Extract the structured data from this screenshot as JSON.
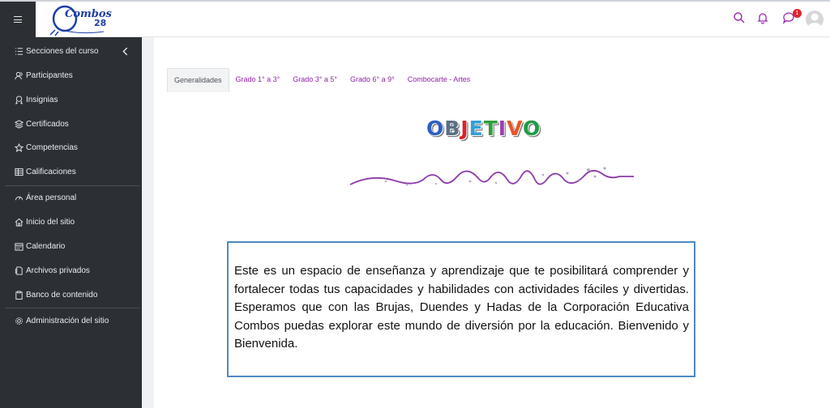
{
  "header": {
    "menu_icon": "hamburger-icon",
    "logo_text": "Combos",
    "logo_number": "28",
    "notification_badge": "1",
    "icons": [
      "search-icon",
      "bell-icon",
      "chat-icon",
      "user-avatar"
    ]
  },
  "sidebar": {
    "items": [
      {
        "label": "Secciones del curso",
        "icon": "list-icon"
      },
      {
        "label": "Participantes",
        "icon": "users-icon"
      },
      {
        "label": "Insignias",
        "icon": "badge-icon"
      },
      {
        "label": "Certificados",
        "icon": "layers-icon"
      },
      {
        "label": "Competencias",
        "icon": "star-icon"
      },
      {
        "label": "Calificaciones",
        "icon": "table-icon"
      },
      {
        "label": "Área personal",
        "icon": "dashboard-icon"
      },
      {
        "label": "Inicio del sitio",
        "icon": "home-icon"
      },
      {
        "label": "Calendario",
        "icon": "calendar-icon"
      },
      {
        "label": "Archivos privados",
        "icon": "file-icon"
      },
      {
        "label": "Banco de contenido",
        "icon": "clipboard-icon"
      },
      {
        "label": "Administración del sitio",
        "icon": "gear-icon"
      }
    ]
  },
  "tabs": [
    {
      "label": "Generalidades",
      "active": true
    },
    {
      "label": "Grado 1° a 3°",
      "active": false
    },
    {
      "label": "Grado 3° a 5°",
      "active": false
    },
    {
      "label": "Grado 6° a 9°",
      "active": false
    },
    {
      "label": "Combocarte - Artes",
      "active": false
    }
  ],
  "content": {
    "heading_letters": [
      {
        "ch": "O",
        "color": "#2d5fc4"
      },
      {
        "ch": "B",
        "color": "#5a6f86"
      },
      {
        "ch": "J",
        "color": "#d5242b"
      },
      {
        "ch": "E",
        "color": "#2fa0d8"
      },
      {
        "ch": "T",
        "color": "#2f9e3b"
      },
      {
        "ch": "I",
        "color": "#9b3db1"
      },
      {
        "ch": "V",
        "color": "#e6572a"
      },
      {
        "ch": "O",
        "color": "#1f9c45"
      }
    ],
    "paragraph": "Este es un espacio de enseñanza y aprendizaje que te posibilitará comprender y fortalecer todas tus capacidades y habilidades con actividades fáciles y divertidas. Esperamos que con las Brujas, Duendes y Hadas de la Corporación Educativa Combos puedas explorar este mundo de diversión por la educación. Bienvenido y Bienvenida."
  },
  "colors": {
    "sidebar_bg": "#2c3035",
    "link": "#8e24aa",
    "box_border": "#4e88c4",
    "squiggle": "#8b3aa8"
  }
}
